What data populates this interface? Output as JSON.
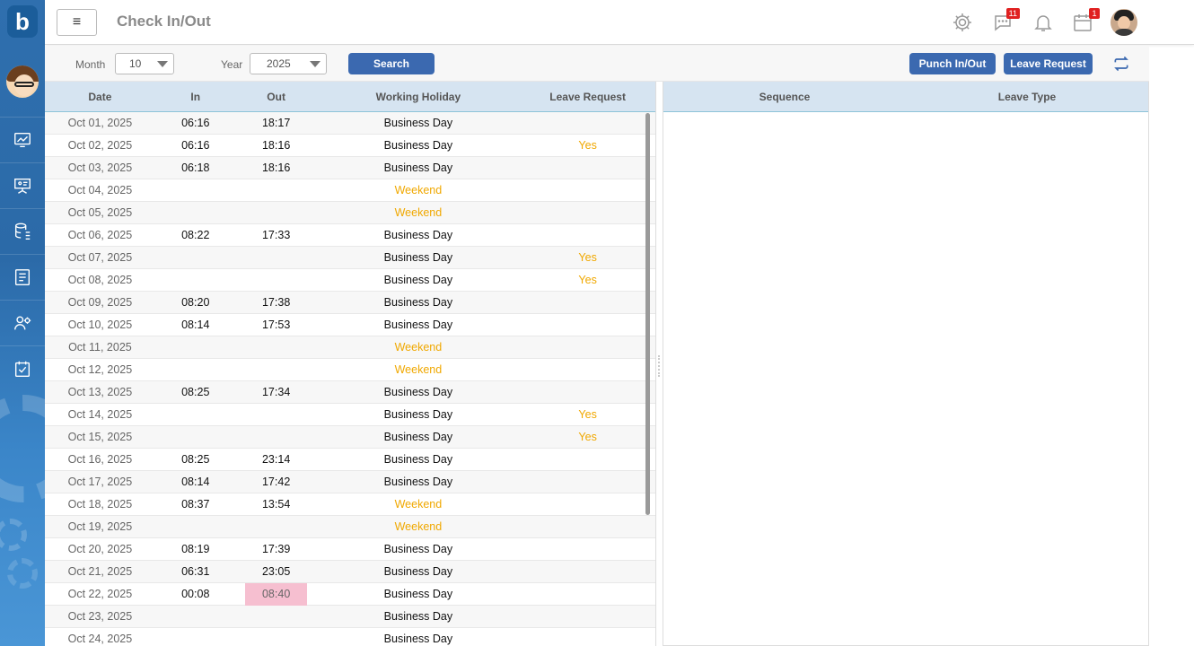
{
  "app": {
    "logo_text": "b"
  },
  "header": {
    "title": "Check In/Out",
    "messages_badge": "11",
    "calendar_badge": "1"
  },
  "sidebar": {
    "items": [
      {
        "icon": "chart-monitor-icon"
      },
      {
        "icon": "presentation-board-icon"
      },
      {
        "icon": "database-icon"
      },
      {
        "icon": "document-list-icon"
      },
      {
        "icon": "user-settings-icon"
      },
      {
        "icon": "checklist-icon"
      }
    ]
  },
  "filters": {
    "month_label": "Month",
    "month_value": "10",
    "year_label": "Year",
    "year_value": "2025",
    "search_label": "Search",
    "punch_label": "Punch In/Out",
    "leave_label": "Leave Request"
  },
  "left_table": {
    "columns": [
      "Date",
      "In",
      "Out",
      "Working Holiday",
      "Leave Request"
    ],
    "rows": [
      {
        "date": "Oct 01, 2025",
        "in": "06:16",
        "out": "18:17",
        "wh": "Business Day",
        "lr": ""
      },
      {
        "date": "Oct 02, 2025",
        "in": "06:16",
        "out": "18:16",
        "wh": "Business Day",
        "lr": "Yes"
      },
      {
        "date": "Oct 03, 2025",
        "in": "06:18",
        "out": "18:16",
        "wh": "Business Day",
        "lr": ""
      },
      {
        "date": "Oct 04, 2025",
        "in": "",
        "out": "",
        "wh": "Weekend",
        "lr": ""
      },
      {
        "date": "Oct 05, 2025",
        "in": "",
        "out": "",
        "wh": "Weekend",
        "lr": ""
      },
      {
        "date": "Oct 06, 2025",
        "in": "08:22",
        "out": "17:33",
        "wh": "Business Day",
        "lr": ""
      },
      {
        "date": "Oct 07, 2025",
        "in": "",
        "out": "",
        "wh": "Business Day",
        "lr": "Yes"
      },
      {
        "date": "Oct 08, 2025",
        "in": "",
        "out": "",
        "wh": "Business Day",
        "lr": "Yes"
      },
      {
        "date": "Oct 09, 2025",
        "in": "08:20",
        "out": "17:38",
        "wh": "Business Day",
        "lr": ""
      },
      {
        "date": "Oct 10, 2025",
        "in": "08:14",
        "out": "17:53",
        "wh": "Business Day",
        "lr": ""
      },
      {
        "date": "Oct 11, 2025",
        "in": "",
        "out": "",
        "wh": "Weekend",
        "lr": ""
      },
      {
        "date": "Oct 12, 2025",
        "in": "",
        "out": "",
        "wh": "Weekend",
        "lr": ""
      },
      {
        "date": "Oct 13, 2025",
        "in": "08:25",
        "out": "17:34",
        "wh": "Business Day",
        "lr": ""
      },
      {
        "date": "Oct 14, 2025",
        "in": "",
        "out": "",
        "wh": "Business Day",
        "lr": "Yes"
      },
      {
        "date": "Oct 15, 2025",
        "in": "",
        "out": "",
        "wh": "Business Day",
        "lr": "Yes"
      },
      {
        "date": "Oct 16, 2025",
        "in": "08:25",
        "out": "23:14",
        "wh": "Business Day",
        "lr": ""
      },
      {
        "date": "Oct 17, 2025",
        "in": "08:14",
        "out": "17:42",
        "wh": "Business Day",
        "lr": ""
      },
      {
        "date": "Oct 18, 2025",
        "in": "08:37",
        "out": "13:54",
        "wh": "Weekend",
        "lr": ""
      },
      {
        "date": "Oct 19, 2025",
        "in": "",
        "out": "",
        "wh": "Weekend",
        "lr": ""
      },
      {
        "date": "Oct 20, 2025",
        "in": "08:19",
        "out": "17:39",
        "wh": "Business Day",
        "lr": ""
      },
      {
        "date": "Oct 21, 2025",
        "in": "06:31",
        "out": "23:05",
        "wh": "Business Day",
        "lr": ""
      },
      {
        "date": "Oct 22, 2025",
        "in": "00:08",
        "out": "08:40",
        "wh": "Business Day",
        "lr": "",
        "out_highlight": true
      },
      {
        "date": "Oct 23, 2025",
        "in": "",
        "out": "",
        "wh": "Business Day",
        "lr": ""
      },
      {
        "date": "Oct 24, 2025",
        "in": "",
        "out": "",
        "wh": "Business Day",
        "lr": ""
      }
    ]
  },
  "right_table": {
    "columns": [
      "Sequence",
      "Leave Type"
    ]
  },
  "colors": {
    "accent": "#3b69b0",
    "weekend_text": "#f0a800",
    "highlight": "#f6bfd0",
    "header_bg": "#d6e4f1"
  }
}
